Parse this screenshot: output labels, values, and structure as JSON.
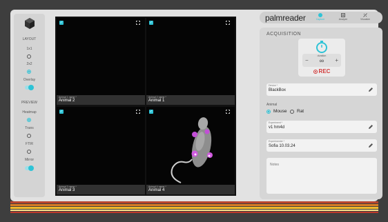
{
  "sidebar": {
    "layout_label": "LAYOUT",
    "opt_1x1": "1x1",
    "opt_2x2": "2x2",
    "overlay_label": "Overlay",
    "preview_label": "PREVIEW",
    "heatmap_label": "Heatmap",
    "trans_label": "Trans",
    "ftir_label": "FTIR",
    "mirror_label": "Mirror"
  },
  "cameras": [
    {
      "caption": "Animal 1 name *",
      "name": "Animal 2"
    },
    {
      "caption": "Animal 2 name *",
      "name": "Animal 1"
    },
    {
      "caption": "Animal 3 name *",
      "name": "Animal 3"
    },
    {
      "caption": "Animal 4 name *",
      "name": "Animal 4"
    }
  ],
  "header": {
    "brand": "palmreader",
    "nav": [
      {
        "label": "Capture",
        "icon": "capture-icon"
      },
      {
        "label": "Analyze",
        "icon": "analyze-icon"
      },
      {
        "label": "Visualize",
        "icon": "visualize-icon"
      }
    ]
  },
  "acquisition": {
    "title": "ACQUISITION",
    "duration_label": "duration",
    "duration_value": "∞",
    "minus": "−",
    "plus": "+",
    "rec_label": "REC",
    "device_caption": "Device *",
    "device_value": "BlackBox",
    "animal_label": "Animal",
    "species": [
      "Mouse",
      "Rat"
    ],
    "experiment_caption": "Experiment *",
    "experiment_value": "v1 hm4d",
    "experimenter_caption": "Experimenter *",
    "experimenter_value": "Sofia 10.03.24",
    "notes_placeholder": "Notes"
  },
  "colors": {
    "accent": "#2ec3d6",
    "record": "#d23a3a",
    "stripe_colors": [
      "#b8452e",
      "#d97c24",
      "#f2b92b",
      "#f7e08a",
      "#c0392b"
    ]
  }
}
